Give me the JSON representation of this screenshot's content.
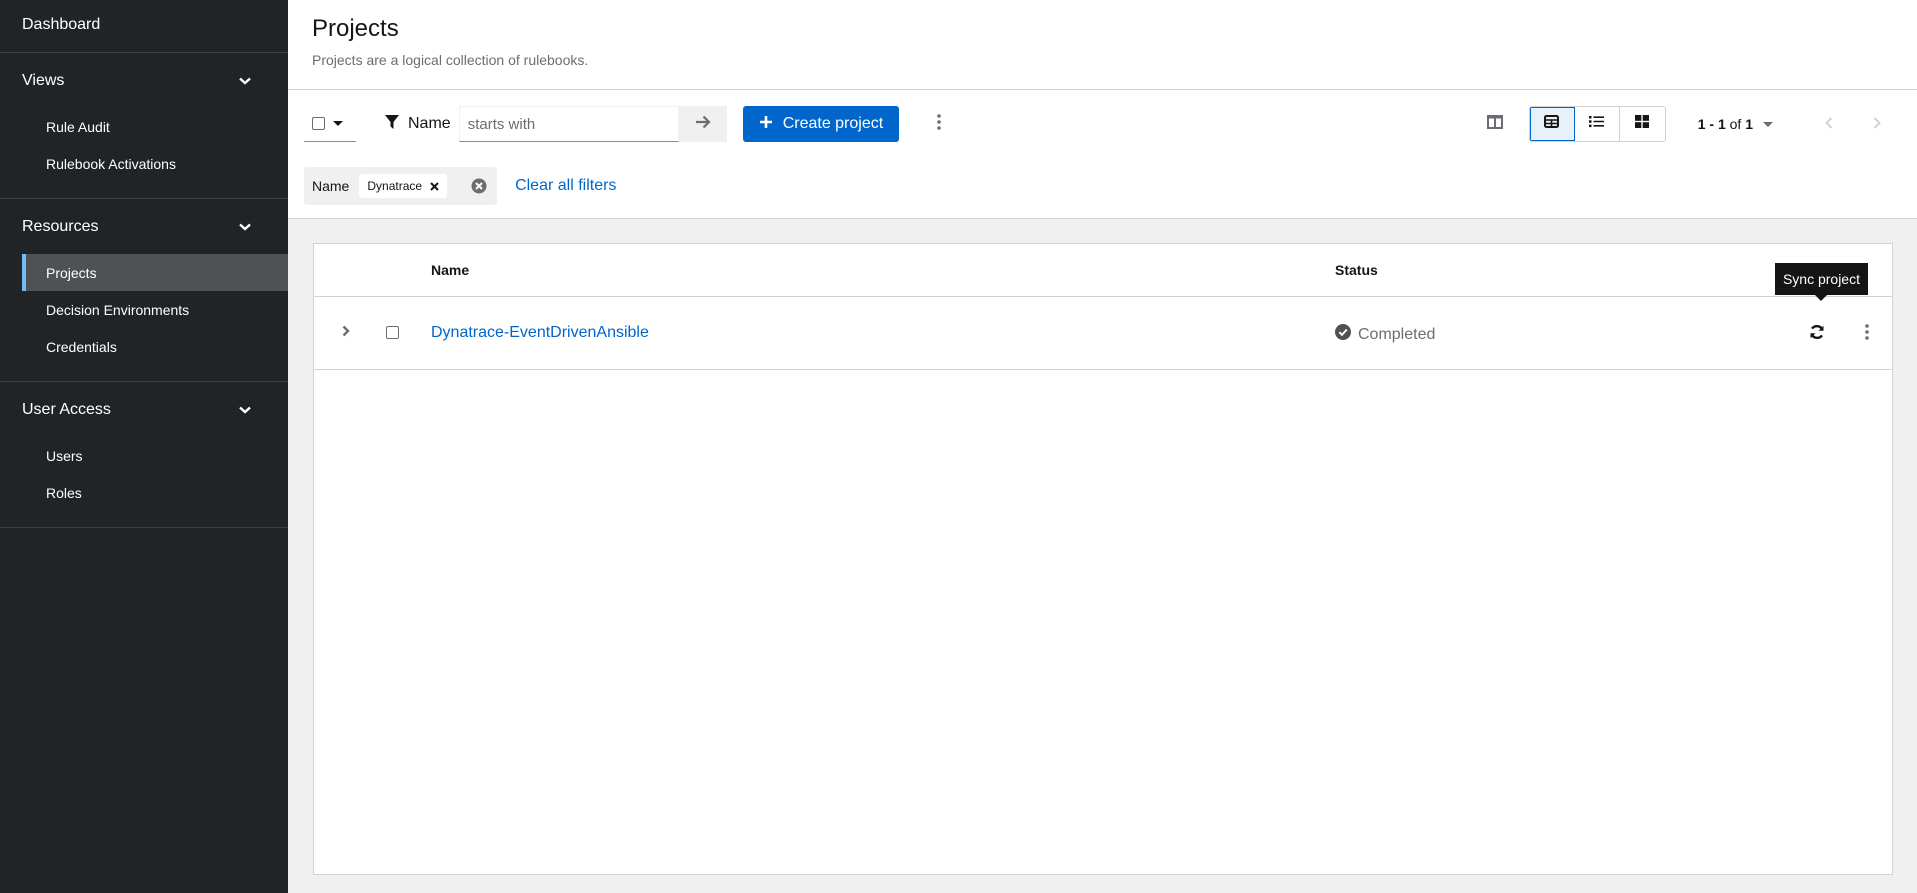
{
  "sidebar": {
    "top_item": "Dashboard",
    "sections": [
      {
        "label": "Views",
        "items": [
          "Rule Audit",
          "Rulebook Activations"
        ]
      },
      {
        "label": "Resources",
        "items": [
          "Projects",
          "Decision Environments",
          "Credentials"
        ],
        "active_item": "Projects"
      },
      {
        "label": "User Access",
        "items": [
          "Users",
          "Roles"
        ]
      }
    ]
  },
  "header": {
    "title": "Projects",
    "description": "Projects are a logical collection of rulebooks."
  },
  "toolbar": {
    "filter_attribute": "Name",
    "filter_placeholder": "starts with",
    "filter_value": "",
    "create_label": "Create project",
    "view_modes": [
      "table",
      "list",
      "cards"
    ],
    "active_view": "table",
    "pagination": {
      "range": "1 - 1",
      "of": "of",
      "total": "1"
    },
    "chips": {
      "category": "Name",
      "values": [
        "Dynatrace"
      ]
    },
    "clear_all_label": "Clear all filters"
  },
  "table": {
    "columns": [
      "Name",
      "Status"
    ],
    "rows": [
      {
        "name": "Dynatrace-EventDrivenAnsible",
        "status": "Completed"
      }
    ],
    "tooltip": "Sync project"
  },
  "colors": {
    "accent": "#0066cc",
    "sidebar_bg": "#212427",
    "active_indicator": "#73bcf7"
  }
}
